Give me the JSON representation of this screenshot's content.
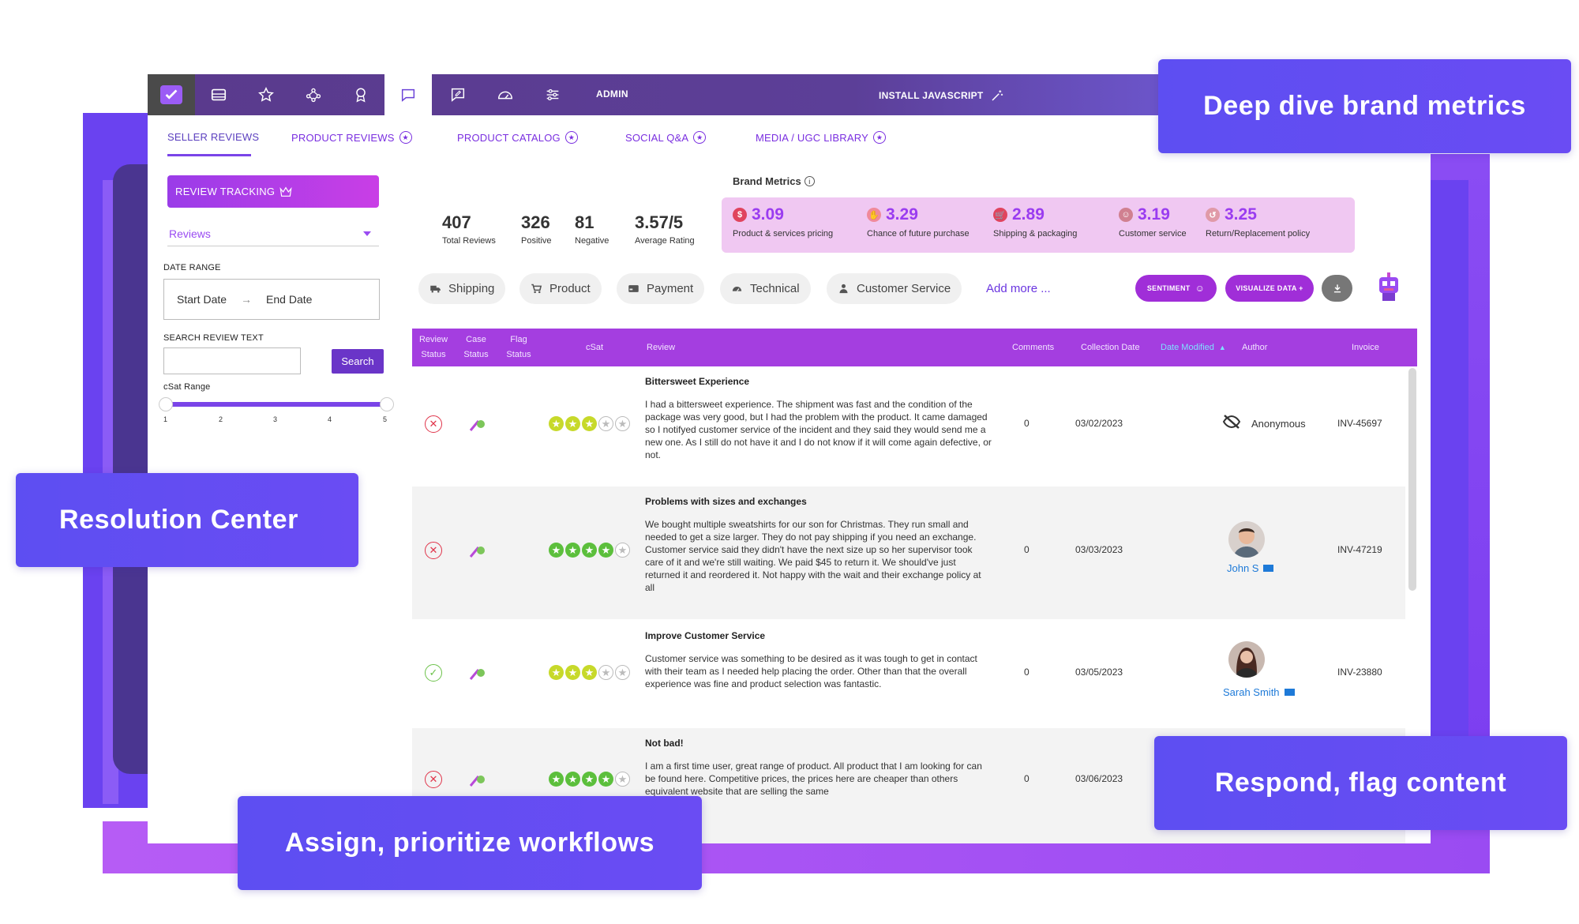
{
  "topbar": {
    "admin_label": "ADMIN",
    "install_label": "INSTALL JAVASCRIPT",
    "icons": [
      "check-icon",
      "inbox-icon",
      "star-icon",
      "network-icon",
      "award-icon",
      "chat-icon",
      "edit-chat-icon",
      "dashboard-icon",
      "sliders-icon"
    ]
  },
  "tabs": {
    "seller_reviews": "SELLER REVIEWS",
    "product_reviews": "PRODUCT REVIEWS",
    "product_catalog": "PRODUCT CATALOG",
    "social_qa": "SOCIAL Q&A",
    "media_library": "MEDIA / UGC LIBRARY"
  },
  "sidebar": {
    "review_tracking": "REVIEW TRACKING",
    "reviews_select": "Reviews",
    "date_range_label": "DATE RANGE",
    "start_date": "Start Date",
    "end_date": "End Date",
    "search_label": "SEARCH REVIEW TEXT",
    "search_button": "Search",
    "csat_label": "cSat Range",
    "csat_ticks": [
      "1",
      "2",
      "3",
      "4",
      "5"
    ]
  },
  "stats": {
    "total": {
      "value": "407",
      "label": "Total Reviews"
    },
    "positive": {
      "value": "326",
      "label": "Positive"
    },
    "negative": {
      "value": "81",
      "label": "Negative"
    },
    "average": {
      "value": "3.57/5",
      "label": "Average Rating"
    }
  },
  "brand_metrics": {
    "title": "Brand Metrics",
    "items": [
      {
        "value": "3.09",
        "label": "Product & services pricing"
      },
      {
        "value": "3.29",
        "label": "Chance of future purchase"
      },
      {
        "value": "2.89",
        "label": "Shipping & packaging"
      },
      {
        "value": "3.19",
        "label": "Customer service"
      },
      {
        "value": "3.25",
        "label": "Return/Replacement policy"
      }
    ]
  },
  "filters": {
    "chips": [
      "Shipping",
      "Product",
      "Payment",
      "Technical",
      "Customer Service"
    ],
    "add_more": "Add more ...",
    "sentiment": "SENTIMENT",
    "visualize": "VISUALIZE DATA +"
  },
  "table": {
    "headers": {
      "review_status_1": "Review",
      "review_status_2": "Status",
      "case_status_1": "Case",
      "case_status_2": "Status",
      "flag_status_1": "Flag",
      "flag_status_2": "Status",
      "csat": "cSat",
      "review": "Review",
      "comments": "Comments",
      "collection_date": "Collection Date",
      "date_modified": "Date Modified",
      "author": "Author",
      "invoice": "Invoice"
    },
    "rows": [
      {
        "title": "Bittersweet Experience",
        "body": "I had a bittersweet experience. The shipment was fast and the condition of the package was very good, but I had the problem with the product. It came damaged so I notifyed customer service of the incident and they said they would send me a new one. As I still do not have it and I do not know if it will come again defective, or not.",
        "comments": "0",
        "date": "03/02/2023",
        "author": "Anonymous",
        "invoice": "INV-45697",
        "rating": 3
      },
      {
        "title": "Problems with sizes and exchanges",
        "body": "We bought multiple sweatshirts for our son for Christmas. They run small and needed to get a size larger. They do not pay shipping if you need an exchange. Customer service said they didn't have the next size up so her supervisor took care of it and we're still waiting. We paid $45 to return it. We should've just returned it and reordered it. Not happy with the wait and their exchange policy at all",
        "comments": "0",
        "date": "03/03/2023",
        "author": "John S",
        "invoice": "INV-47219",
        "rating": 4
      },
      {
        "title": "Improve Customer Service",
        "body": "Customer service was something to be desired as it was tough to get in contact with their team as I needed help placing the order. Other than that the overall experience was fine and product selection was fantastic.",
        "comments": "0",
        "date": "03/05/2023",
        "author": "Sarah Smith",
        "invoice": "INV-23880",
        "rating": 3
      },
      {
        "title": "Not bad!",
        "body": "I am a first time user, great range of product. All product that I am looking for can be found here. Competitive prices, the prices here are cheaper than others equivalent website that are selling the same",
        "comments": "0",
        "date": "03/06/2023",
        "author": "",
        "invoice": "",
        "rating": 4
      }
    ]
  },
  "callouts": {
    "deep_dive": "Deep dive brand metrics",
    "resolution": "Resolution Center",
    "respond": "Respond, flag content",
    "assign": "Assign, prioritize workflows"
  },
  "colors": {
    "accent": "#9a3cf0",
    "topbar": "#5a3a8c",
    "callout": "#5d4ef2",
    "table_header": "#a43ee0"
  }
}
